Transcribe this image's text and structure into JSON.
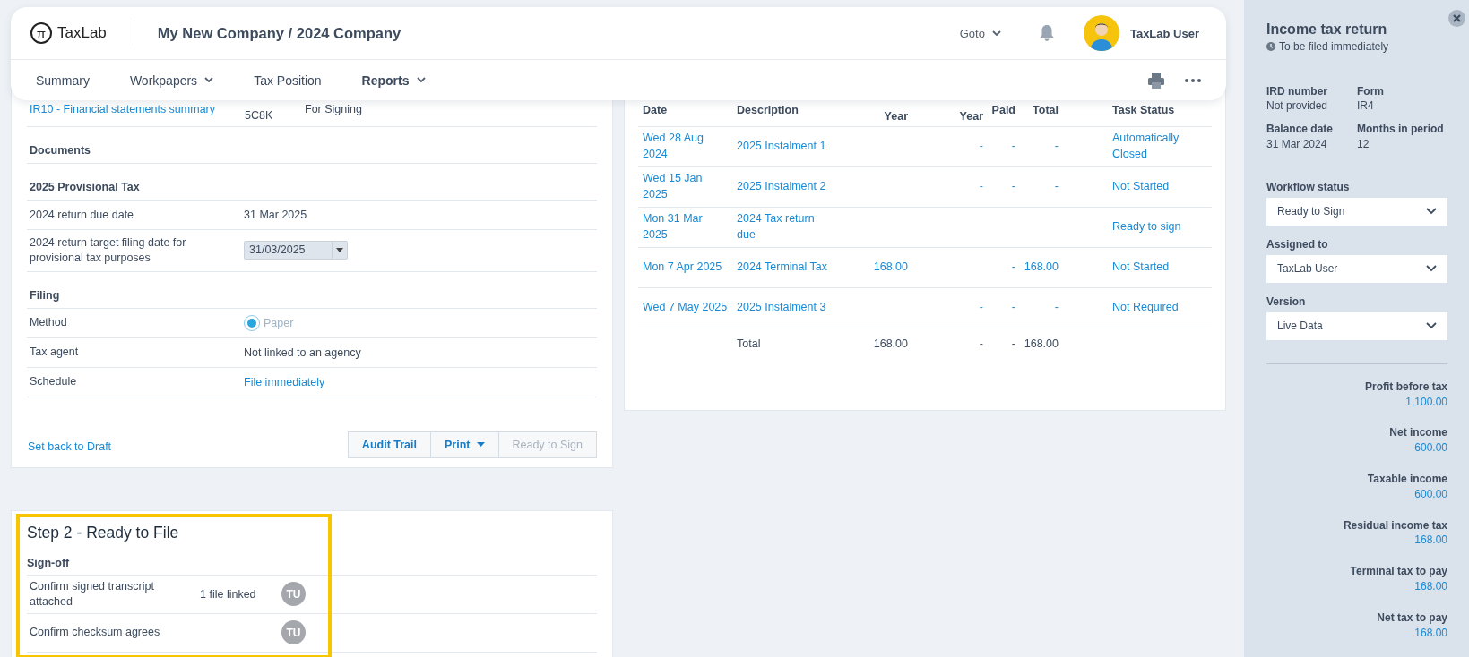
{
  "header": {
    "logo_mark": "π",
    "logo": "TaxLab",
    "title": "My New Company / 2024 Company",
    "goto": "Goto",
    "user": "TaxLab User"
  },
  "nav": [
    {
      "label": "Summary",
      "selected": false,
      "dropdown": false
    },
    {
      "label": "Workpapers",
      "selected": false,
      "dropdown": true
    },
    {
      "label": "Tax Position",
      "selected": false,
      "dropdown": false
    },
    {
      "label": "Reports",
      "selected": true,
      "dropdown": true
    }
  ],
  "return_card": {
    "top_row": {
      "link": "IR10 - Financial statements summary",
      "code": "5C8K",
      "status": "For Signing"
    },
    "sections": [
      {
        "heading": "Documents"
      },
      {
        "heading": "2025 Provisional Tax",
        "rows": [
          {
            "kind": "text",
            "label": "2024 return due date",
            "value": "31 Mar 2025"
          },
          {
            "kind": "date",
            "label": "2024 return target filing date for provisional tax purposes",
            "value": "31/03/2025"
          }
        ]
      },
      {
        "heading": "Filing",
        "rows": [
          {
            "kind": "radio",
            "label": "Method",
            "value": "Paper",
            "checked": true
          },
          {
            "kind": "text",
            "label": "Tax agent",
            "value": "Not linked to an agency"
          },
          {
            "kind": "link",
            "label": "Schedule",
            "value": "File immediately"
          }
        ]
      }
    ],
    "back_link": "Set back to Draft",
    "buttons": [
      {
        "label": "Audit Trail",
        "disabled": false,
        "dropdown": false
      },
      {
        "label": "Print",
        "disabled": false,
        "dropdown": true
      },
      {
        "label": "Ready to Sign",
        "disabled": true,
        "dropdown": false
      }
    ]
  },
  "schedule": {
    "columns": [
      "Date",
      "Description",
      "Year",
      "Year",
      "Paid",
      "Total",
      "Task Status"
    ],
    "rows": [
      {
        "kind": "item",
        "date": "Wed 28 Aug 2024",
        "description": "2025 Instalment 1",
        "col_4": "-",
        "paid": "-",
        "total": "-",
        "task_status": "Automatically Closed"
      },
      {
        "kind": "item",
        "date": "Wed 15 Jan 2025",
        "description": "2025 Instalment 2",
        "col_4": "-",
        "paid": "-",
        "total": "-",
        "task_status": "Not Started"
      },
      {
        "kind": "item",
        "date": "Mon 31 Mar 2025",
        "description": "2024 Tax return due",
        "task_status": "Ready to sign"
      },
      {
        "kind": "item",
        "date": "Mon 7 Apr 2025",
        "description": "2024 Terminal Tax",
        "col_3": "168.00",
        "paid": "-",
        "total": "168.00",
        "task_status": "Not Started"
      },
      {
        "kind": "item",
        "date": "Wed 7 May 2025",
        "description": "2025 Instalment 3",
        "col_4": "-",
        "paid": "-",
        "total": "-",
        "task_status": "Not Required"
      },
      {
        "kind": "total",
        "description": "Total",
        "col_3": "168.00",
        "col_4": "-",
        "paid": "-",
        "total": "168.00"
      }
    ]
  },
  "step_card": {
    "title": "Step 2 - Ready to File",
    "section": "Sign-off",
    "highlighted": true,
    "items": [
      {
        "label": "Confirm signed transcript attached",
        "note": "1 file linked",
        "initials": "TU"
      },
      {
        "label": "Confirm checksum agrees",
        "initials": "TU"
      }
    ]
  },
  "sidebar": {
    "title": "Income tax return",
    "subtitle": "To be filed immediately",
    "facts": [
      {
        "label": "IRD number",
        "value": "Not provided"
      },
      {
        "label": "Form",
        "value": "IR4"
      },
      {
        "label": "Balance date",
        "value": "31 Mar 2024"
      },
      {
        "label": "Months in period",
        "value": "12"
      }
    ],
    "selects": [
      {
        "label": "Workflow status",
        "value": "Ready to Sign"
      },
      {
        "label": "Assigned to",
        "value": "TaxLab User"
      },
      {
        "label": "Version",
        "value": "Live Data"
      }
    ],
    "summary": [
      {
        "label": "Profit before tax",
        "value": "1,100.00"
      },
      {
        "label": "Net income",
        "value": "600.00"
      },
      {
        "label": "Taxable income",
        "value": "600.00"
      },
      {
        "label": "Residual income tax",
        "value": "168.00"
      },
      {
        "label": "Terminal tax to pay",
        "value": "168.00"
      },
      {
        "label": "Net tax to pay",
        "value": "168.00"
      }
    ]
  }
}
